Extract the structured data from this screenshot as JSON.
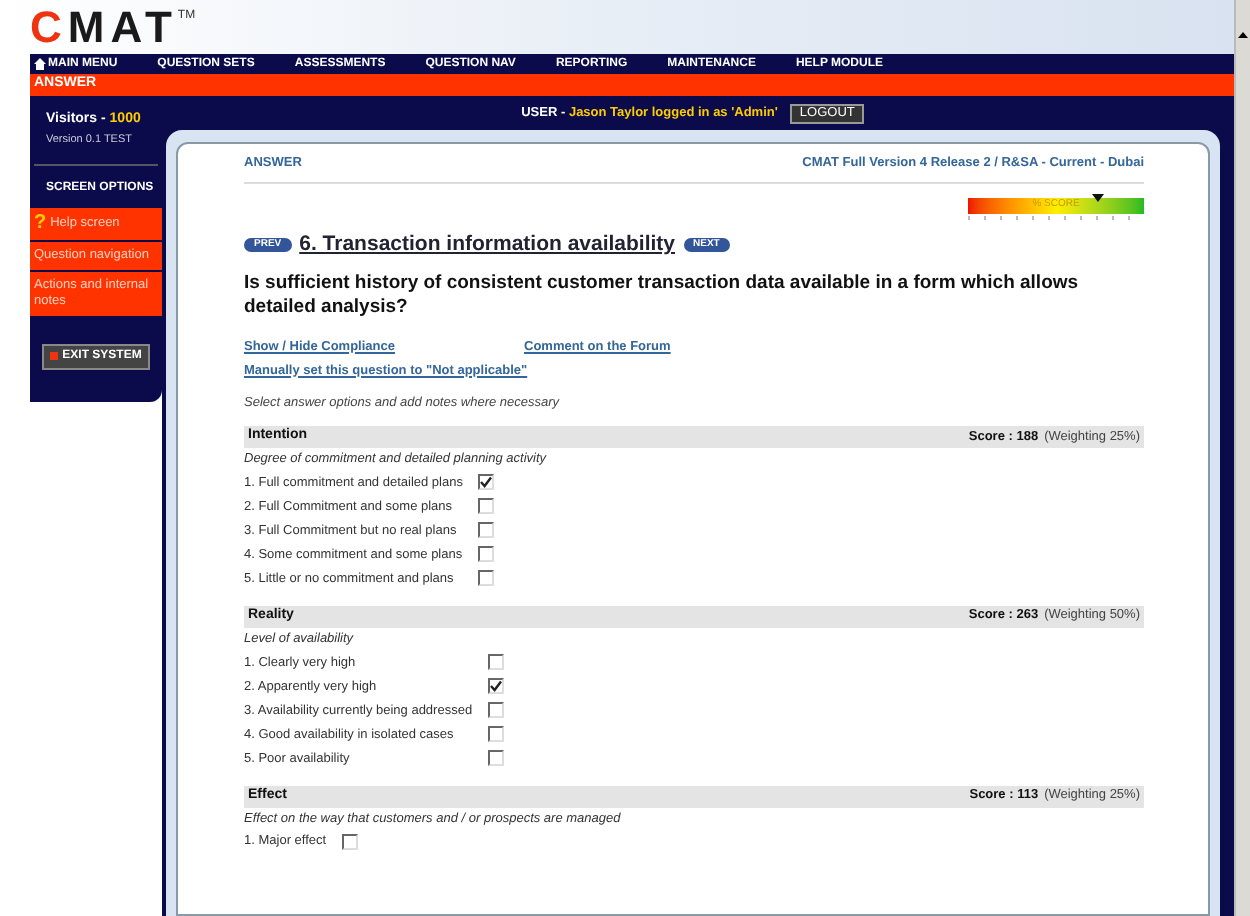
{
  "logo": {
    "text": "CMAT",
    "tm": "TM"
  },
  "nav": [
    {
      "label": "MAIN MENU",
      "kind": "home"
    },
    {
      "label": "QUESTION SETS"
    },
    {
      "label": "ASSESSMENTS"
    },
    {
      "label": "QUESTION NAV"
    },
    {
      "label": "REPORTING"
    },
    {
      "label": "MAINTENANCE"
    },
    {
      "label": "HELP MODULE"
    }
  ],
  "page_bar": "ANSWER",
  "sidebar": {
    "visitors_label": "Visitors - ",
    "visitors_count": "1000",
    "version": "Version 0.1 TEST",
    "options_heading": "SCREEN OPTIONS",
    "options": [
      {
        "label": "Help screen",
        "kind": "help",
        "icon": "?"
      },
      {
        "label": "Question navigation",
        "kind": "plain"
      },
      {
        "label": "Actions and internal notes",
        "kind": "plain"
      }
    ],
    "exit": "EXIT SYSTEM"
  },
  "user_bar": {
    "label": "USER - ",
    "text": "Jason Taylor logged in as 'Admin'",
    "logout": "LOGOUT"
  },
  "panel": {
    "breadcrumb": "ANSWER",
    "context": "CMAT Full Version 4 Release 2 / R&SA - Current - Dubai",
    "score_meter": {
      "label": "% SCORE",
      "level": 0.74
    },
    "prev": "PREV",
    "next": "NEXT",
    "question_title": "6. Transaction information availability",
    "question": "Is sufficient history of consistent customer transaction data available in a form which allows detailed analysis?",
    "links": [
      "Show / Hide Compliance",
      "Comment on the Forum",
      "Manually set this question to \"Not applicable\""
    ],
    "instruction": "Select answer options and add notes where necessary",
    "sections": [
      {
        "title": "Intention",
        "score": "Score : 188",
        "weighting": "(Weighting 25%)",
        "description": "Degree of commitment and detailed planning activity",
        "options": [
          {
            "label": "1. Full commitment and detailed plans",
            "checked": true
          },
          {
            "label": "2. Full Commitment and some plans",
            "checked": false
          },
          {
            "label": "3. Full Commitment but no real plans",
            "checked": false
          },
          {
            "label": "4. Some commitment and some plans",
            "checked": false
          },
          {
            "label": "5. Little or no commitment and plans",
            "checked": false
          }
        ]
      },
      {
        "title": "Reality",
        "score": "Score : 263",
        "weighting": "(Weighting 50%)",
        "description": "Level of availability",
        "options": [
          {
            "label": "1. Clearly very high",
            "checked": false
          },
          {
            "label": "2. Apparently very high",
            "checked": true
          },
          {
            "label": "3. Availability currently being addressed",
            "checked": false
          },
          {
            "label": "4. Good availability in isolated cases",
            "checked": false
          },
          {
            "label": "5. Poor availability",
            "checked": false
          }
        ]
      },
      {
        "title": "Effect",
        "score": "Score : 113",
        "weighting": "(Weighting 25%)",
        "description": "Effect on the way that customers and / or prospects are managed",
        "options": [
          {
            "label": "1. Major effect",
            "checked": false
          }
        ]
      }
    ]
  }
}
